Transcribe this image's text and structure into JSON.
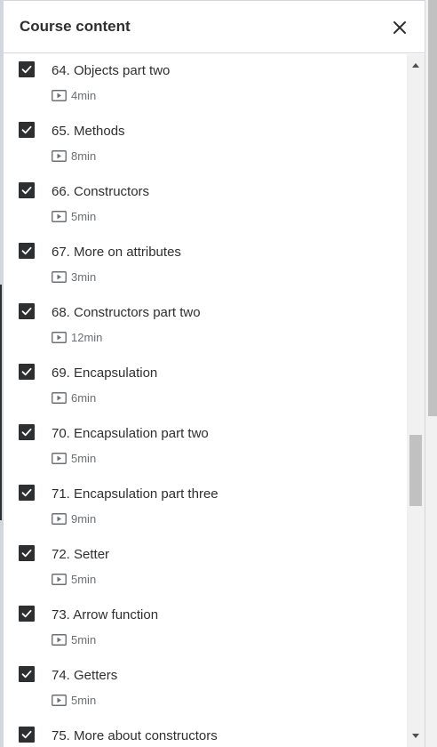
{
  "header": {
    "title": "Course content",
    "close_icon": "close-icon"
  },
  "lectures": [
    {
      "title": "64. Objects part two",
      "duration": "4min",
      "completed": true
    },
    {
      "title": "65. Methods",
      "duration": "8min",
      "completed": true
    },
    {
      "title": "66. Constructors",
      "duration": "5min",
      "completed": true
    },
    {
      "title": "67. More on attributes",
      "duration": "3min",
      "completed": true
    },
    {
      "title": "68. Constructors part two",
      "duration": "12min",
      "completed": true
    },
    {
      "title": "69. Encapsulation",
      "duration": "6min",
      "completed": true
    },
    {
      "title": "70. Encapsulation part two",
      "duration": "5min",
      "completed": true
    },
    {
      "title": "71. Encapsulation part three",
      "duration": "9min",
      "completed": true
    },
    {
      "title": "72. Setter",
      "duration": "5min",
      "completed": true
    },
    {
      "title": "73. Arrow function",
      "duration": "5min",
      "completed": true
    },
    {
      "title": "74. Getters",
      "duration": "5min",
      "completed": true
    },
    {
      "title": "75. More about constructors",
      "duration": "",
      "completed": true
    }
  ],
  "scroll": {
    "position_fraction": 0.62
  },
  "colors": {
    "text": "#2d2f31",
    "muted": "#6a6f73",
    "border": "#d1d7dc",
    "checkbox": "#2d2f31"
  }
}
